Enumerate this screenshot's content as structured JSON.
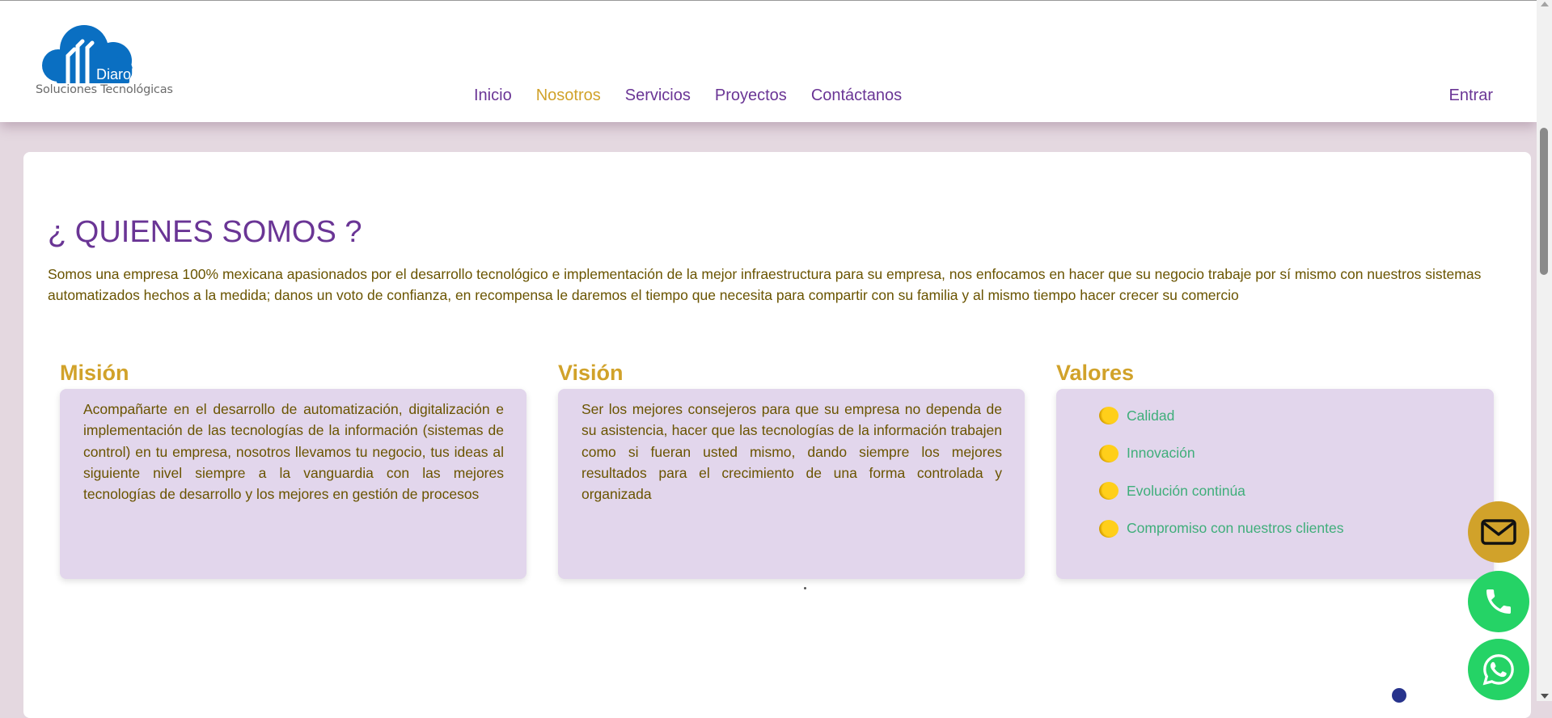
{
  "brand": {
    "name": "Diarol",
    "tagline": "Soluciones Tecnológicas"
  },
  "nav": {
    "links": [
      {
        "label": "Inicio",
        "active": false
      },
      {
        "label": "Nosotros",
        "active": true
      },
      {
        "label": "Servicios",
        "active": false
      },
      {
        "label": "Proyectos",
        "active": false
      },
      {
        "label": "Contáctanos",
        "active": false
      }
    ],
    "login_label": "Entrar"
  },
  "main": {
    "title": "¿ QUIENES SOMOS ?",
    "intro": "Somos una empresa 100% mexicana apasionados por el desarrollo tecnológico e implementación de la mejor infraestructura para su empresa, nos enfocamos en hacer que su negocio trabaje por sí mismo con nuestros sistemas automatizados hechos a la medida; danos un voto de confianza, en recompensa le daremos el tiempo que necesita para compartir con su familia y al mismo tiempo hacer crecer su comercio",
    "mission": {
      "title": "Misión",
      "text": "Acompañarte en el desarrollo de automatización, digitalización e implementación de las tecnologías de la información (sistemas de control) en tu empresa, nosotros llevamos tu negocio, tus ideas al siguiente nivel siempre a la vanguardia con las mejores tecnologías de desarrollo y los mejores en gestión de procesos"
    },
    "vision": {
      "title": "Visión",
      "text": "Ser los mejores consejeros para que su empresa no dependa de su asistencia, hacer que las tecnologías de la información trabajen como si fueran usted mismo, dando siempre los mejores resultados para el crecimiento de una forma controlada y organizada"
    },
    "values": {
      "title": "Valores",
      "items": [
        "Calidad",
        "Innovación",
        "Evolución continúa",
        "Compromiso con nuestros clientes"
      ]
    }
  },
  "floating_buttons": {
    "mail_icon": "mail-icon",
    "phone_icon": "phone-icon",
    "whatsapp_icon": "whatsapp-icon"
  },
  "colors": {
    "primary_purple": "#6a3595",
    "accent_gold": "#d1a22a",
    "body_text": "#6a5400",
    "values_green": "#3fae7a",
    "box_lavender": "#e2d6ec",
    "whatsapp_green": "#25d366",
    "page_background": "#e4d8e0"
  }
}
